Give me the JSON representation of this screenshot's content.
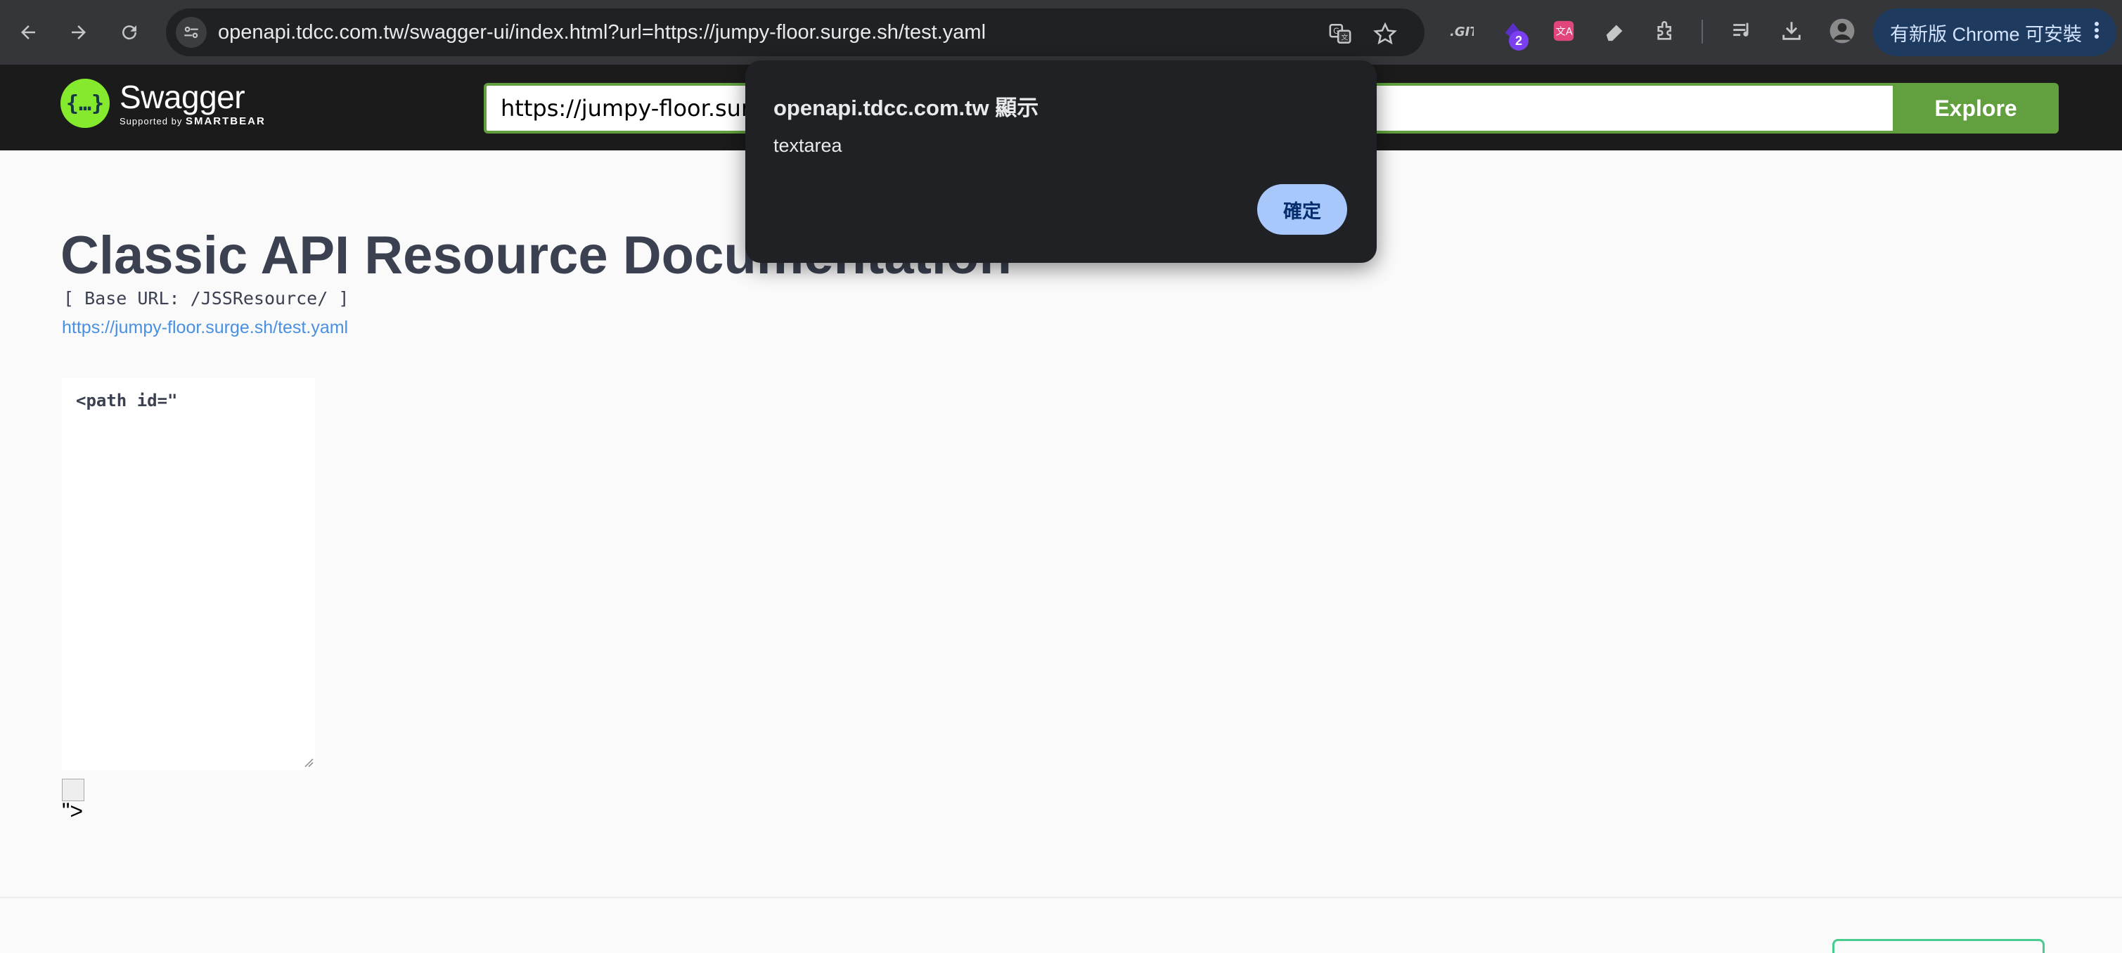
{
  "browser": {
    "url": "openapi.tdcc.com.tw/swagger-ui/index.html?url=https://jumpy-floor.surge.sh/test.yaml",
    "extension_badge": "2",
    "update_button_label": "有新版 Chrome 可安裝"
  },
  "swagger": {
    "logo_title": "Swagger",
    "logo_sub_prefix": "Supported by",
    "logo_sub_brand": "SMARTBEAR",
    "spec_url_value": "https://jumpy-floor.surge.sh/test.yaml",
    "explore_label": "Explore"
  },
  "main": {
    "title": "Classic API Resource Documentation",
    "base_url": "[ Base URL: /JSSResource/ ]",
    "spec_link": "https://jumpy-floor.surge.sh/test.yaml",
    "textarea_value": "<path id=\"",
    "trailing_text": "\">"
  },
  "dialog": {
    "heading": "openapi.tdcc.com.tw 顯示",
    "message": "textarea",
    "ok_label": "確定"
  },
  "colors": {
    "accent_green": "#62a03f",
    "link_blue": "#4990e2",
    "dialog_button": "#a8c7fa"
  }
}
